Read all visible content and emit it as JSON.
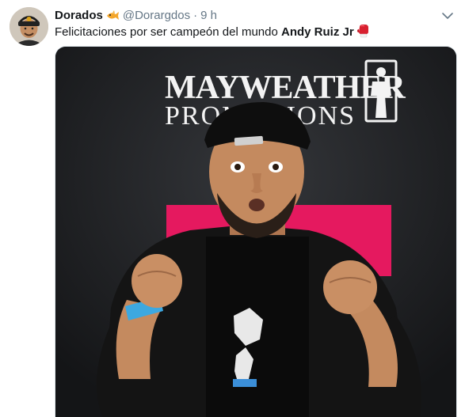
{
  "tweet": {
    "display_name": "Dorados",
    "badge_icon": "fish-emoji-icon",
    "handle": "@Dorargdos",
    "separator": "·",
    "time": "9 h",
    "text_prefix": "Felicitaciones por ser campeón del mundo ",
    "text_bold": "Andy Ruiz Jr",
    "trailing_icon": "boxing-glove-icon",
    "caret_icon": "chevron-down-icon"
  },
  "photo": {
    "banner_line1": "MAYWEATHER",
    "banner_line2": "PROMOTIONS"
  },
  "colors": {
    "name": "#14171a",
    "meta": "#657786",
    "backdrop": "#1e1f22",
    "accent_pink": "#e5195f"
  }
}
